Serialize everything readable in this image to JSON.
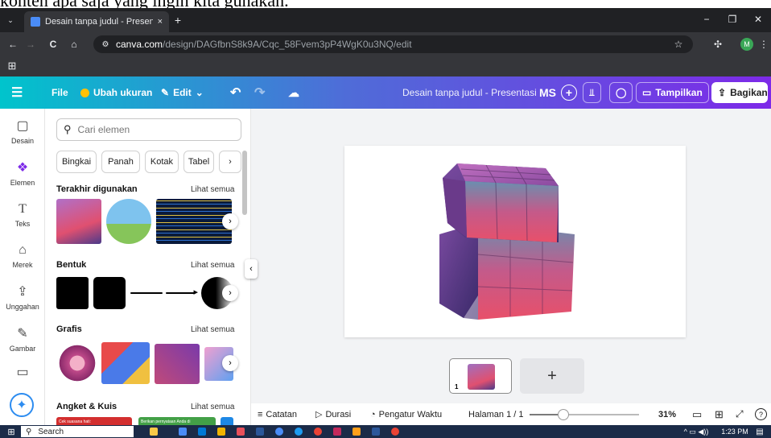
{
  "top_strip_text": "konten apa saja yang ingin kita gunakan.",
  "browser": {
    "tab_title": "Desain tanpa judul - Presentasi",
    "tab_close": "×",
    "new_tab": "+",
    "url_domain": "canva.com",
    "url_path": "/design/DAGfbnS8k9A/Cqc_58Fvem3pP4WgK0u3NQ/edit",
    "profile_initial": "M",
    "window_controls": [
      "−",
      "❐",
      "✕"
    ],
    "nav_icons": [
      "←",
      "→",
      "C",
      "⌂"
    ],
    "apps_icon": "apps-grid-icon"
  },
  "canva_topbar": {
    "menu_icon": "☰",
    "file_label": "File",
    "resize_label": "Ubah ukuran",
    "edit_label": "Edit",
    "undo": "↶",
    "redo": "↷",
    "document_title": "Desain tanpa judul - Presentasi",
    "avatar": "MS",
    "add_collab": "+",
    "present_label": "Tampilkan",
    "share_label": "Bagikan"
  },
  "sidebar": {
    "items": [
      {
        "label": "Desain",
        "icon": "▢"
      },
      {
        "label": "Elemen",
        "icon": "❖"
      },
      {
        "label": "Teks",
        "icon": "T"
      },
      {
        "label": "Merek",
        "icon": "⌂"
      },
      {
        "label": "Unggahan",
        "icon": "⇪"
      },
      {
        "label": "Gambar",
        "icon": "✎"
      },
      {
        "label": "",
        "icon": "▭"
      }
    ],
    "magic_icon": "✦"
  },
  "panel": {
    "search_placeholder": "Cari elemen",
    "chips": [
      "Bingkai",
      "Panah",
      "Kotak",
      "Tabel",
      "›"
    ],
    "sections": [
      {
        "title": "Terakhir digunakan",
        "link": "Lihat semua"
      },
      {
        "title": "Bentuk",
        "link": "Lihat semua"
      },
      {
        "title": "Grafis",
        "link": "Lihat semua"
      },
      {
        "title": "Angket & Kuis",
        "link": "Lihat semua"
      }
    ],
    "quiz_card_1": "Cek suasana hati:",
    "quiz_card_2": "Berikan pernyataan Anda di",
    "scroll_arrow": "›",
    "collapse_arrow": "‹"
  },
  "page_thumb": {
    "number": "1",
    "add_page": "+"
  },
  "bottombar": {
    "notes": "Catatan",
    "duration": "Durasi",
    "timer": "Pengatur Waktu",
    "page": "Halaman 1 / 1",
    "zoom": "31%",
    "zoom_fraction": 0.31,
    "help": "?"
  },
  "taskbar": {
    "search": "Search",
    "time": "1:23 PM"
  },
  "colors": {
    "browser_dark": "#202124",
    "canva_teal": "#00c4cc",
    "canva_purple": "#7d2ae8",
    "taskbar": "#1b2b48"
  }
}
